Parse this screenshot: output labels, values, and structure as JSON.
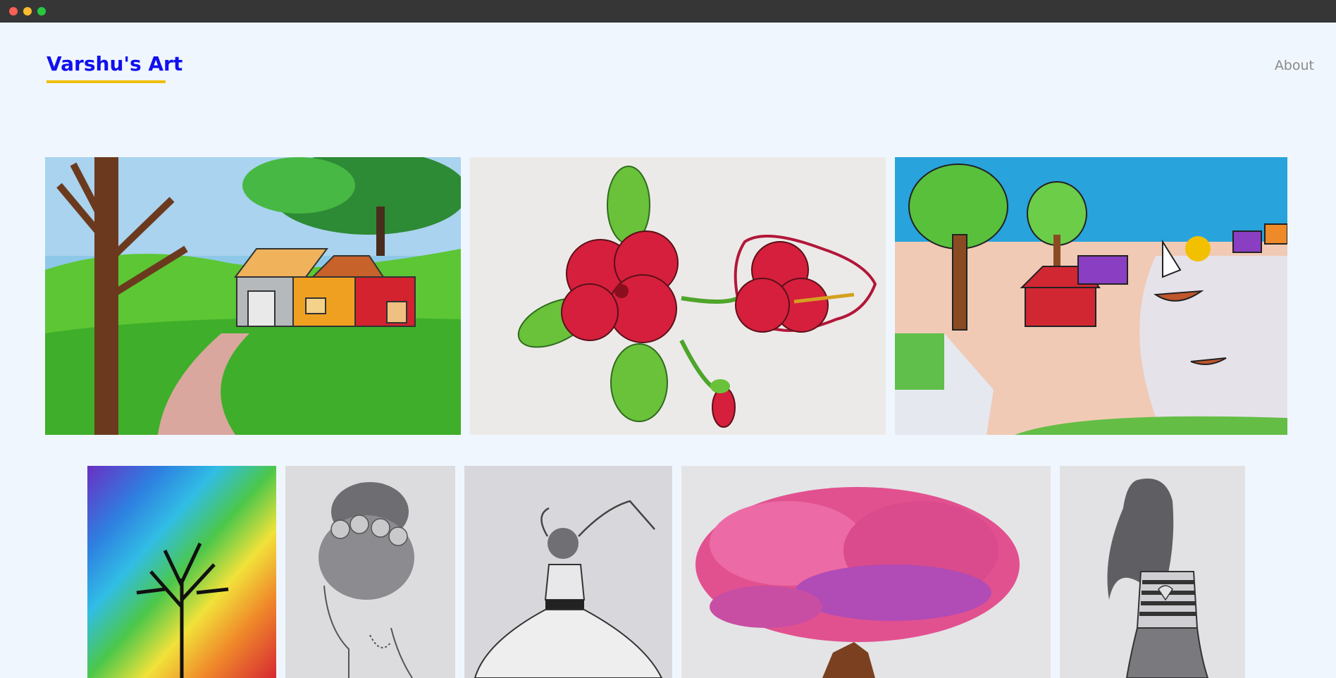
{
  "site": {
    "title": "Varshu's Art"
  },
  "nav": {
    "about_label": "About"
  },
  "gallery": {
    "artworks": [
      {
        "id": "village-house-landscape",
        "subject": "house in green landscape with trees"
      },
      {
        "id": "red-hibiscus",
        "subject": "red hibiscus flowers with leaves"
      },
      {
        "id": "river-village-scene",
        "subject": "village by the river with boats"
      },
      {
        "id": "rainbow-tree",
        "subject": "black tree silhouette on rainbow background"
      },
      {
        "id": "girl-hair-bun-sketch",
        "subject": "pencil sketch of girl with flowered bun"
      },
      {
        "id": "dancer-dress-sketch",
        "subject": "pencil sketch of girl in dress with bow"
      },
      {
        "id": "pink-blossom-tree",
        "subject": "pink blossom tree crayon drawing"
      },
      {
        "id": "long-hair-girl-sketch",
        "subject": "pencil sketch of long-haired girl"
      }
    ]
  },
  "colors": {
    "accent": "#1010ee",
    "underline": "#f0be0b",
    "background": "#f0f6fe"
  }
}
